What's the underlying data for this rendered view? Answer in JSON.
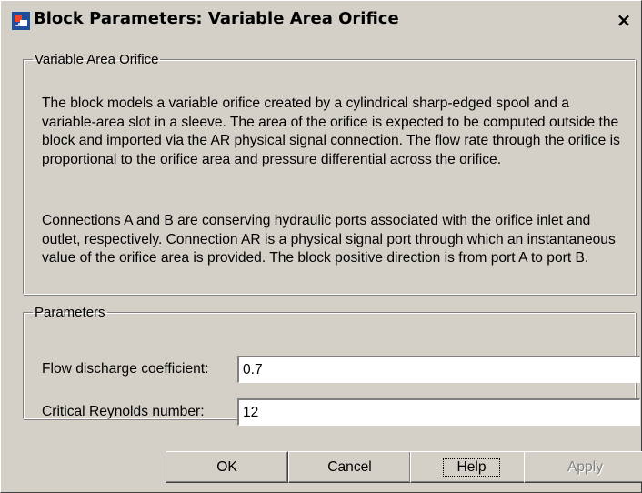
{
  "window": {
    "title": "Block Parameters: Variable Area Orifice",
    "close_glyph": "×"
  },
  "description": {
    "legend": "Variable Area Orifice",
    "paragraph1": "The block models a variable orifice created by a cylindrical sharp-edged spool and a variable-area slot in a sleeve. The area of the orifice is expected to be computed outside the block and imported via the AR physical signal connection. The flow rate through the orifice is proportional to the orifice area and pressure differential across the orifice.",
    "paragraph2": "Connections A and B are conserving hydraulic ports associated with the orifice inlet and outlet, respectively. Connection AR is a physical signal port through which an instantaneous value of the orifice area is provided. The block positive direction is from port A to port B."
  },
  "parameters": {
    "legend": "Parameters",
    "fields": [
      {
        "label": "Flow discharge coefficient:",
        "value": "0.7"
      },
      {
        "label": "Critical Reynolds number:",
        "value": "12"
      }
    ]
  },
  "buttons": {
    "ok": "OK",
    "cancel": "Cancel",
    "help": "Help",
    "apply": "Apply"
  },
  "icons": {
    "app": "simulink-block-icon",
    "close": "close-icon"
  },
  "colors": {
    "dialog_bg": "#d4d0c8",
    "input_bg": "#ffffff",
    "disabled_text": "#808080"
  }
}
